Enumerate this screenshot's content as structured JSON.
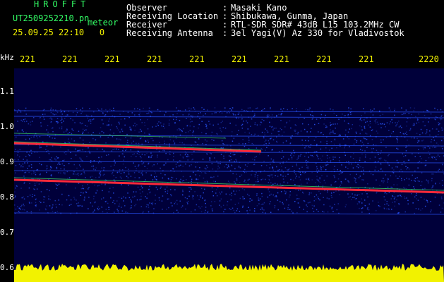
{
  "header": {
    "brand": "HROFFT",
    "file_name": "UT2509252210.pn",
    "file_tag": "meteor",
    "datetime": "25.09.25 22:10",
    "count": "0",
    "fields": [
      {
        "key": "Observer",
        "value": "Masaki Kano"
      },
      {
        "key": "Receiving Location",
        "value": "Shibukawa, Gunma, Japan"
      },
      {
        "key": "Receiver",
        "value": "RTL-SDR SDR# 43dB L15 103.2MHz CW"
      },
      {
        "key": "Receiving Antenna",
        "value": "3el Yagi(V) Az 330 for Vladivostok"
      }
    ]
  },
  "axis": {
    "unit": "kHz",
    "time_ticks": [
      "221",
      "221",
      "221",
      "221",
      "221",
      "221",
      "221",
      "221",
      "221",
      "2220"
    ],
    "freq_ticks": [
      "1.1",
      "1.0",
      "0.9",
      "0.8",
      "0.7",
      "0.6"
    ]
  },
  "colors": {
    "background": "#000000",
    "spectrogram_bg": "#00003a",
    "noise_blue": "#2a55ff",
    "signal_red": "#ff2a3a",
    "signal_green": "#44ee66",
    "baseline_yellow": "#f2f200",
    "brand_green": "#33ff66"
  }
}
